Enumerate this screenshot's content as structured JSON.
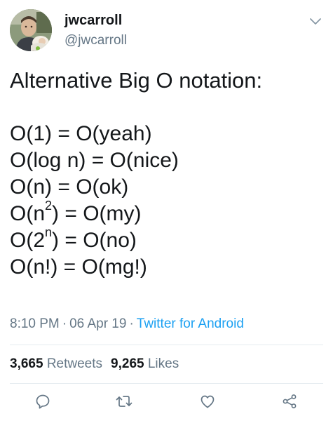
{
  "user": {
    "display_name": "jwcarroll",
    "handle": "@jwcarroll"
  },
  "tweet": {
    "intro": "Alternative Big O notation:",
    "lines": [
      {
        "base": "O(1) = O(yeah)"
      },
      {
        "base": "O(log n) = O(nice)"
      },
      {
        "base": "O(n) = O(ok)"
      },
      {
        "pre": "O(n",
        "sup": "2",
        "post": ") = O(my)"
      },
      {
        "pre": "O(2",
        "sup": "n",
        "post": ") = O(no)"
      },
      {
        "base": "O(n!) = O(mg!)"
      }
    ]
  },
  "meta": {
    "time": "8:10 PM",
    "date": "06 Apr 19",
    "source": "Twitter for Android",
    "separator": "·"
  },
  "stats": {
    "retweets_count": "3,665",
    "retweets_label": "Retweets",
    "likes_count": "9,265",
    "likes_label": "Likes"
  },
  "icons": {
    "caret": "chevron-down-icon",
    "reply": "reply-icon",
    "retweet": "retweet-icon",
    "like": "heart-icon",
    "share": "share-icon"
  },
  "colors": {
    "text": "#14171a",
    "secondary": "#657786",
    "accent": "#1da1f2",
    "divider": "#e6ecf0"
  }
}
